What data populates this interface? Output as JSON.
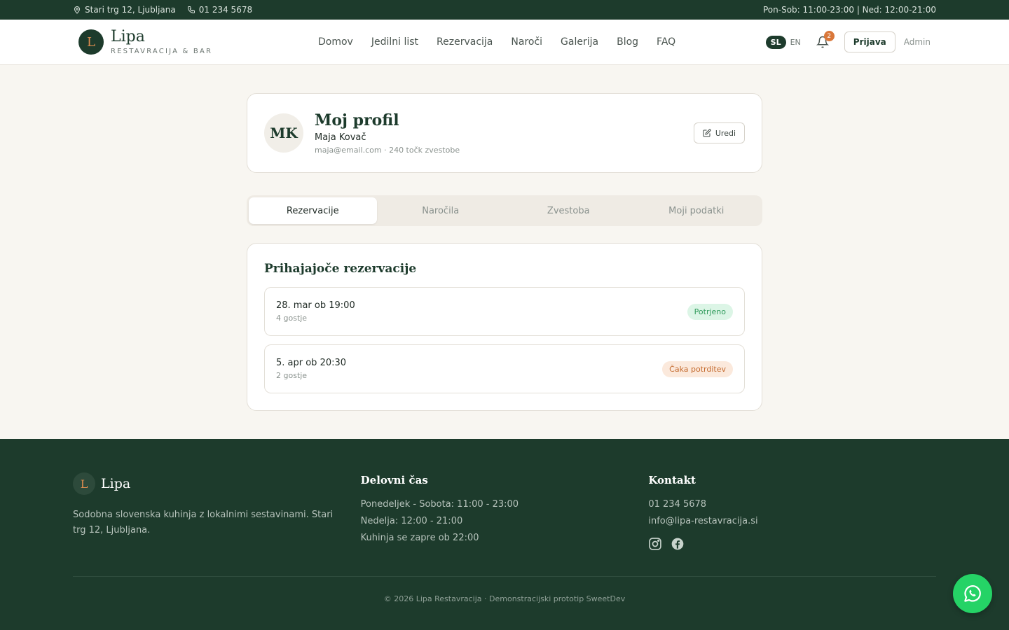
{
  "topbar": {
    "address": "Stari trg 12, Ljubljana",
    "phone": "01 234 5678",
    "hours": "Pon-Sob: 11:00-23:00 | Ned: 12:00-21:00"
  },
  "header": {
    "logo_letter": "L",
    "logo_name": "Lipa",
    "logo_sub": "RESTAVRACIJA & BAR",
    "nav": [
      "Domov",
      "Jedilni list",
      "Rezervacija",
      "Naroči",
      "Galerija",
      "Blog",
      "FAQ"
    ],
    "lang_active": "SL",
    "lang_other": "EN",
    "notifications": "2",
    "login": "Prijava",
    "admin": "Admin"
  },
  "profile": {
    "initials": "MK",
    "title": "Moj profil",
    "name": "Maja Kovač",
    "meta": "maja@email.com · 240 točk zvestobe",
    "edit": "Uredi"
  },
  "tabs": [
    "Rezervacije",
    "Naročila",
    "Zvestoba",
    "Moji podatki"
  ],
  "reservations": {
    "title": "Prihajajoče rezervacije",
    "items": [
      {
        "date": "28. mar ob 19:00",
        "guests": "4 gostje",
        "status": "Potrjeno"
      },
      {
        "date": "5. apr ob 20:30",
        "guests": "2 gostje",
        "status": "Čaka potrditev"
      }
    ]
  },
  "footer": {
    "logo_letter": "L",
    "logo_name": "Lipa",
    "description": "Sodobna slovenska kuhinja z lokalnimi sestavinami. Stari trg 12, Ljubljana.",
    "hours_title": "Delovni čas",
    "hours": [
      "Ponedeljek - Sobota: 11:00 - 23:00",
      "Nedelja: 12:00 - 21:00",
      "Kuhinja se zapre ob 22:00"
    ],
    "contact_title": "Kontakt",
    "contact_phone": "01 234 5678",
    "contact_email": "info@lipa-restavracija.si",
    "copyright": "© 2026 Lipa Restavracija · Demonstracijski prototip SweetDev"
  },
  "colors": {
    "brand_green": "#1d3b2c",
    "accent_orange": "#d98b4f",
    "whatsapp": "#25d366"
  }
}
